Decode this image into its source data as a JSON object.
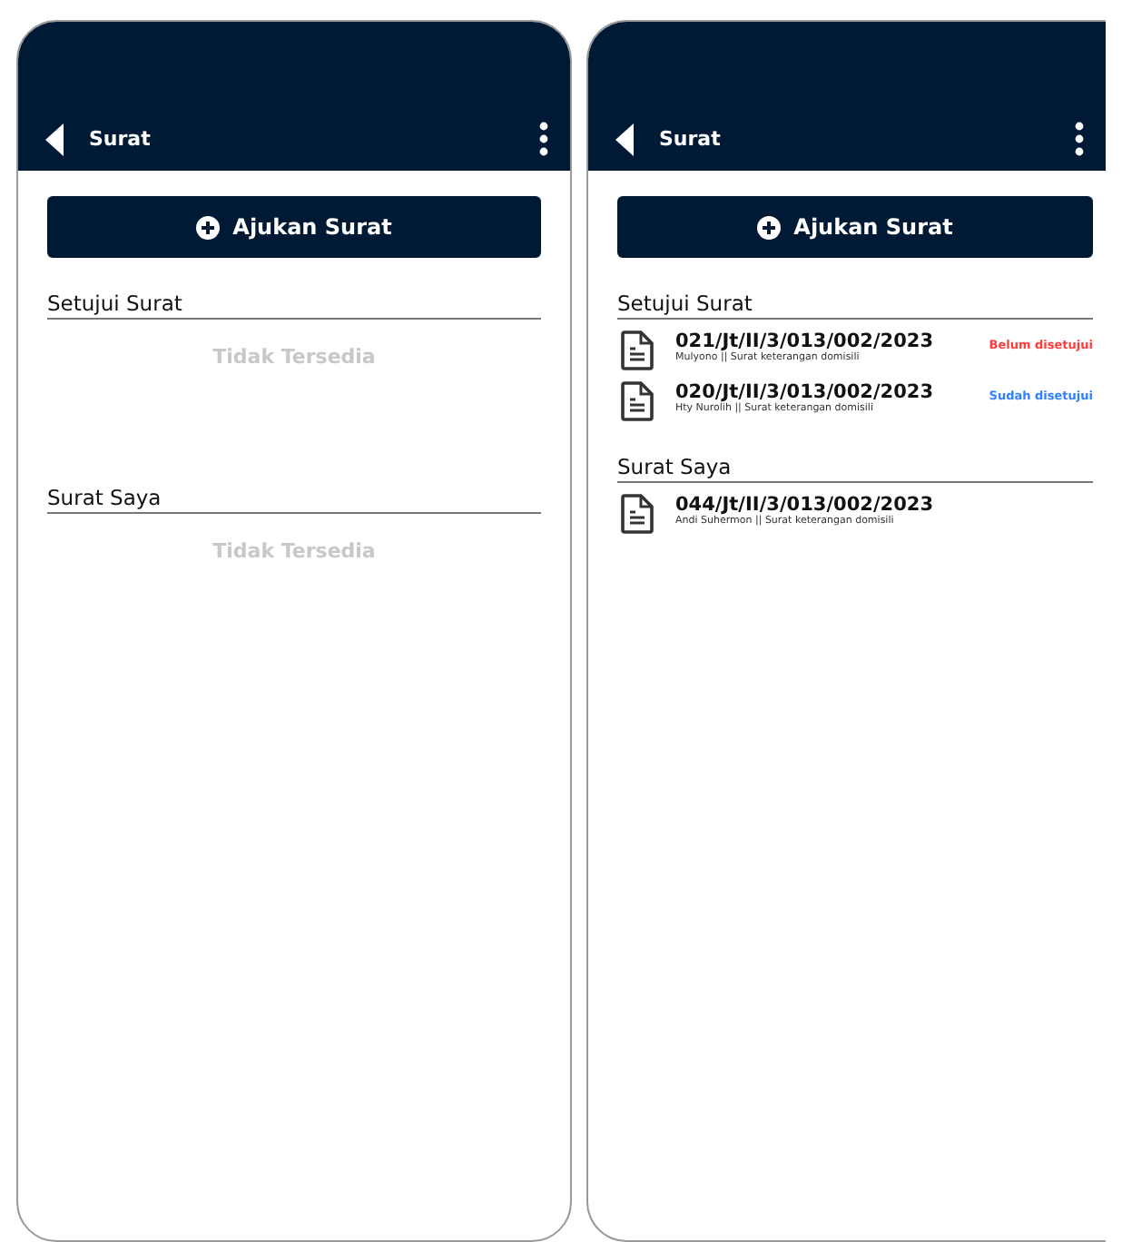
{
  "screens": [
    {
      "title": "Surat",
      "button": "Ajukan Surat",
      "sections": [
        {
          "title": "Setujui Surat",
          "empty_text": "Tidak Tersedia"
        },
        {
          "title": "Surat Saya",
          "empty_text": "Tidak Tersedia"
        }
      ]
    },
    {
      "title": "Surat",
      "button": "Ajukan Surat",
      "sections": [
        {
          "title": "Setujui Surat",
          "items": [
            {
              "number": "021/Jt/II/3/013/002/2023",
              "subtitle": "Mulyono || Surat keterangan domisili",
              "status": "Belum disetujui",
              "color": "#ff3b3b"
            },
            {
              "number": "020/Jt/II/3/013/002/2023",
              "subtitle": "Hty Nurolih || Surat keterangan domisili",
              "status": "Sudah disetujui",
              "color": "#2f7fff"
            }
          ]
        },
        {
          "title": "Surat Saya",
          "items": [
            {
              "number": "044/Jt/II/3/013/002/2023",
              "subtitle": "Andi Suhermon || Surat keterangan domisili"
            }
          ]
        }
      ]
    }
  ]
}
